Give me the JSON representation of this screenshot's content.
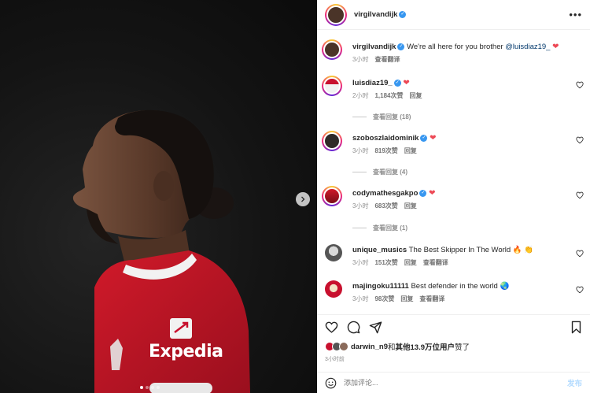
{
  "post": {
    "author": "virgilvandijk",
    "sponsor_text": "Expedia",
    "carousel": {
      "total": 4,
      "active": 1
    }
  },
  "header": {
    "username": "virgilvandijk",
    "more": "•••"
  },
  "caption": {
    "username": "virgilvandijk",
    "text": " We're all here for you brother ",
    "mention": "@luisdiaz19_",
    "time": "3小时",
    "translate": "查看翻译"
  },
  "comments": [
    {
      "username": "luisdiaz19_",
      "text": "",
      "emoji_heart": true,
      "time": "2小时",
      "likes": "1,184次赞",
      "reply": "回复",
      "translate": "",
      "replies_label": "查看回复 (18)",
      "verified": true,
      "ring": true
    },
    {
      "username": "szoboszlaidominik",
      "text": "",
      "emoji_heart": true,
      "time": "3小时",
      "likes": "819次赞",
      "reply": "回复",
      "translate": "",
      "replies_label": "查看回复 (4)",
      "verified": true,
      "ring": true
    },
    {
      "username": "codymathesgakpo",
      "text": "",
      "emoji_heart": true,
      "time": "3小时",
      "likes": "683次赞",
      "reply": "回复",
      "translate": "",
      "replies_label": "查看回复 (1)",
      "verified": true,
      "ring": true
    },
    {
      "username": "unique_musics",
      "text": " The Best Skipper In The World 🔥 👏",
      "emoji_heart": false,
      "time": "3小时",
      "likes": "151次赞",
      "reply": "回复",
      "translate": "查看翻译",
      "replies_label": "",
      "verified": false,
      "ring": false
    },
    {
      "username": "majingoku11111",
      "text": " Best defender in the world 🌏",
      "emoji_heart": false,
      "time": "3小时",
      "likes": "98次赞",
      "reply": "回复",
      "translate": "查看翻译",
      "replies_label": "",
      "verified": false,
      "ring": false
    }
  ],
  "likes_line": {
    "user": "darwin_n9",
    "mid": "和",
    "others": "其他13.9万位用户",
    "tail": "赞了"
  },
  "post_time": "3小时前",
  "add_comment": {
    "placeholder": "添加评论...",
    "post_label": "发布"
  },
  "colors": {
    "accent": "#3897f0",
    "heart": "#ed4956",
    "post_disabled": "#b3dbff",
    "kit_red": "#c8102e"
  },
  "icons": [
    "more-icon",
    "heart-icon",
    "comment-icon",
    "share-icon",
    "bookmark-icon",
    "emoji-icon",
    "chevron-right-icon",
    "verified-icon"
  ]
}
